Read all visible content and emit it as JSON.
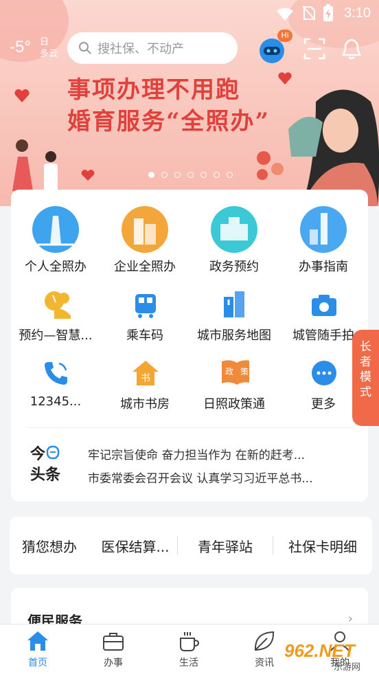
{
  "status_bar": {
    "time": "3:10"
  },
  "header": {
    "weather": {
      "temp": "-5°",
      "day_label": "日",
      "condition": "多云"
    },
    "search_placeholder": "搜社保、不动产",
    "robot_badge": "Hi"
  },
  "banner": {
    "line1": "事项办理不用跑",
    "line2": "婚育服务“全照办”",
    "slide_count": 7,
    "active_slide": 1
  },
  "services": [
    {
      "label": "个人全照办",
      "icon": "person-lighthouse-icon"
    },
    {
      "label": "企业全照办",
      "icon": "enterprise-building-icon"
    },
    {
      "label": "政务预约",
      "icon": "government-hall-icon"
    },
    {
      "label": "办事指南",
      "icon": "guide-tower-icon"
    },
    {
      "label": "预约—智慧...",
      "icon": "smart-appointment-icon"
    },
    {
      "label": "乘车码",
      "icon": "bus-code-icon"
    },
    {
      "label": "城市服务地图",
      "icon": "city-map-icon"
    },
    {
      "label": "城管随手拍",
      "icon": "camera-icon"
    },
    {
      "label": "12345...",
      "icon": "hotline-phone-icon"
    },
    {
      "label": "城市书房",
      "icon": "book-house-icon"
    },
    {
      "label": "日照政策通",
      "icon": "policy-book-icon"
    },
    {
      "label": "更多",
      "icon": "more-icon"
    }
  ],
  "headlines": {
    "logo_line1": "今",
    "logo_line2": "头条",
    "items": [
      "牢记宗旨使命 奋力担当作为 在新的赶考...",
      "市委常委会召开会议 认真学习习近平总书..."
    ]
  },
  "suggestions": {
    "title": "猜您想办",
    "items": [
      "医保结算...",
      "青年驿站",
      "社保卡明细"
    ]
  },
  "convenience": {
    "title": "便民服务"
  },
  "elder_mode": "长者模式",
  "tabs": [
    {
      "label": "首页",
      "icon": "home-icon",
      "active": true
    },
    {
      "label": "办事",
      "icon": "briefcase-icon",
      "active": false
    },
    {
      "label": "生活",
      "icon": "coffee-cup-icon",
      "active": false
    },
    {
      "label": "资讯",
      "icon": "leaf-icon",
      "active": false
    },
    {
      "label": "我的",
      "icon": "user-icon",
      "active": false
    }
  ],
  "watermark": {
    "text": "962.NET",
    "sub": "乐游网"
  },
  "colors": {
    "accent": "#2a8de8",
    "banner_text": "#e0413d",
    "elder_tab": "#f06a4a"
  }
}
